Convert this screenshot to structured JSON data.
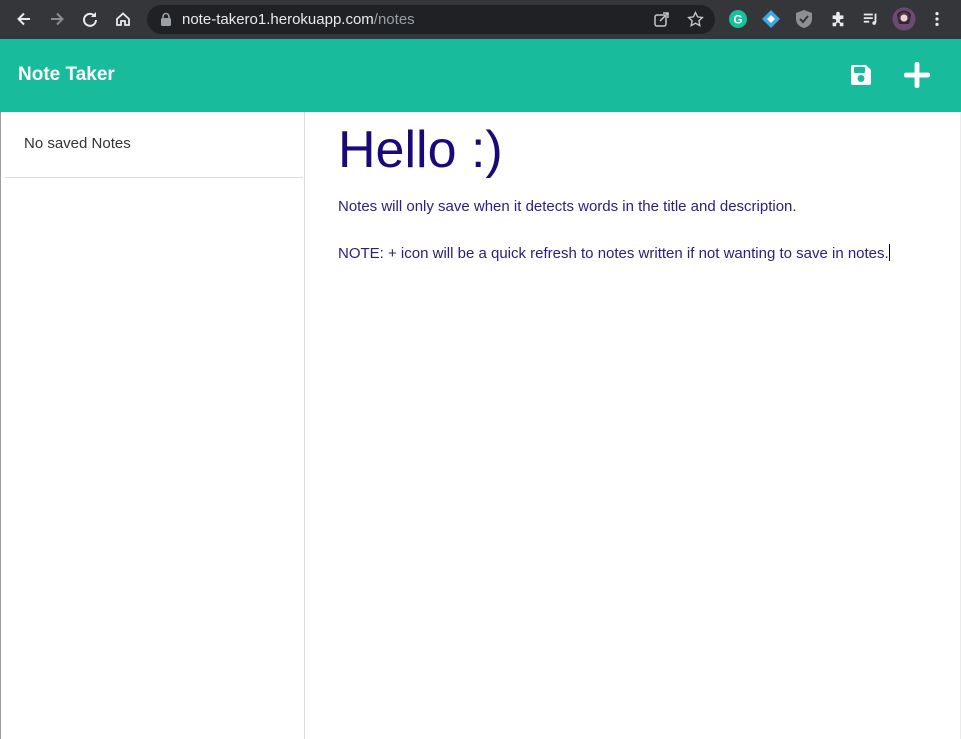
{
  "browser": {
    "url_domain": "note-takero1.herokuapp.com",
    "url_path": "/notes",
    "colors": {
      "toolbar": "#35363a",
      "omnibox": "#202124"
    }
  },
  "app": {
    "title": "Note Taker",
    "header_color": "#18bc9c",
    "save_icon": "save-icon",
    "new_icon": "plus-icon"
  },
  "sidebar": {
    "empty_label": "No saved Notes"
  },
  "note": {
    "title": "Hello :)",
    "body_line1": "Notes will only save when it detects words in the title and description.",
    "body_line2": "NOTE: + icon will be a quick refresh to notes written if not wanting to save in notes."
  }
}
